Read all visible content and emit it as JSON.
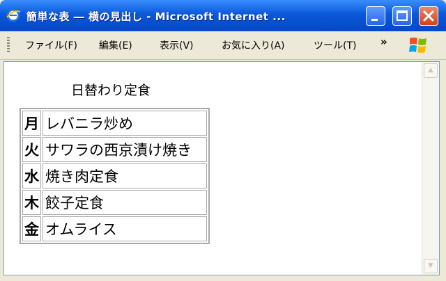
{
  "window": {
    "title": "簡単な表 ― 横の見出し - Microsoft Internet ..."
  },
  "menu": {
    "items": [
      "ファイル(F)",
      "編集(E)",
      "表示(V)",
      "お気に入り(A)",
      "ツール(T)"
    ],
    "overflow": "»"
  },
  "page": {
    "caption": "日替わり定食",
    "rows": [
      {
        "day": "月",
        "dish": "レバニラ炒め"
      },
      {
        "day": "火",
        "dish": "サワラの西京漬け焼き"
      },
      {
        "day": "水",
        "dish": "焼き肉定食"
      },
      {
        "day": "木",
        "dish": "餃子定食"
      },
      {
        "day": "金",
        "dish": "オムライス"
      }
    ]
  },
  "icons": {
    "app": "internet-explorer-icon",
    "minimize": "minimize-icon",
    "maximize": "maximize-icon",
    "close": "close-icon",
    "logo": "windows-logo-icon"
  }
}
